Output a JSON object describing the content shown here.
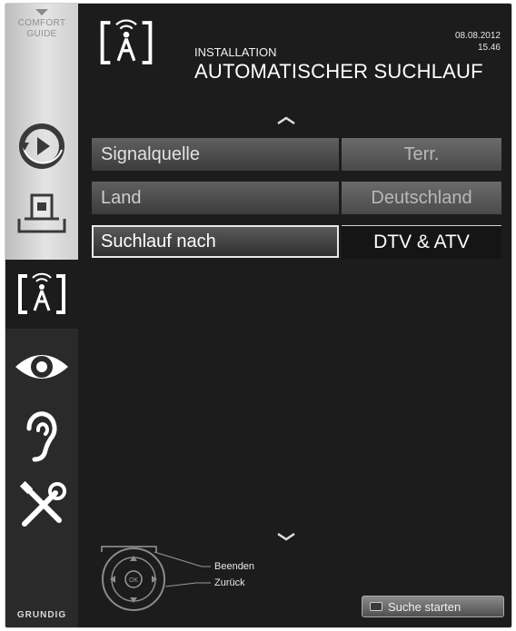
{
  "sidebar": {
    "comfort_guide": {
      "line1": "COMFORT",
      "line2": "GUIDE"
    },
    "items": [
      {
        "icon": "source-input-icon"
      },
      {
        "icon": "network-monitor-icon"
      },
      {
        "icon": "installation-antenna-icon",
        "active": true
      },
      {
        "icon": "eye-picture-icon"
      },
      {
        "icon": "ear-sound-icon"
      },
      {
        "icon": "tools-settings-icon"
      }
    ],
    "brand": "GRUNDIG"
  },
  "header": {
    "icon": "installation-antenna-icon",
    "section": "INSTALLATION",
    "title": "AUTOMATISCHER SUCHLAUF",
    "date": "08.08.2012",
    "time": "15.46"
  },
  "menu": {
    "rows": [
      {
        "label": "Signalquelle",
        "value": "Terr."
      },
      {
        "label": "Land",
        "value": "Deutschland"
      },
      {
        "label": "Suchlauf nach",
        "value": "DTV & ATV",
        "selected": true
      }
    ]
  },
  "footer": {
    "hints": [
      "Beenden",
      "Zurück"
    ],
    "remote_center": "OK",
    "start_button": "Suche starten"
  }
}
